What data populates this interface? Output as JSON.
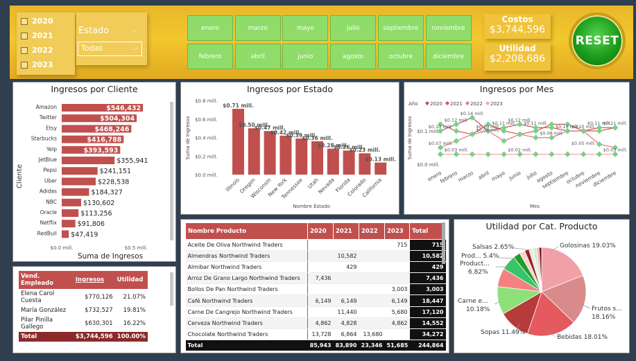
{
  "filters": {
    "years": [
      "2020",
      "2021",
      "2022",
      "2023"
    ],
    "estado_label": "Estado",
    "estado_value": "Todas",
    "months": [
      "enero",
      "marzo",
      "mayo",
      "julio",
      "septiembre",
      "noviembre",
      "febrero",
      "abril",
      "junio",
      "agosto",
      "octubre",
      "diciembre"
    ]
  },
  "kpis": {
    "costos_label": "Costos",
    "costos_value": "$3,744,596",
    "utilidad_label": "Utilidad",
    "utilidad_value": "$2,208,686"
  },
  "reset_label": "RESET",
  "colors": {
    "accent": "#c0504d",
    "green": "#8fdc6b",
    "gold": "#f0c33a"
  },
  "clientes": {
    "title": "Ingresos por Cliente",
    "ylabel": "Cliente",
    "xlabel": "Suma de Ingresos",
    "ticks": [
      "$0.0 mill.",
      "$0.5 mill."
    ],
    "chart_data": {
      "type": "bar",
      "categories": [
        "Amazon",
        "Twitter",
        "Etsy",
        "Starbucks",
        "Yelp",
        "JetBlue",
        "Pepsi",
        "Uber",
        "Adidas",
        "NBC",
        "Oracle",
        "Netflix",
        "RedBull"
      ],
      "values": [
        546432,
        504304,
        468246,
        416788,
        393593,
        355941,
        241151,
        228538,
        184327,
        130602,
        113256,
        91806,
        47419
      ],
      "labels": [
        "$546,432",
        "$504,304",
        "$468,246",
        "$416,788",
        "$393,593",
        "$355,941",
        "$241,151",
        "$228,538",
        "$184,327",
        "$130,602",
        "$113,256",
        "$91,806",
        "$47,419"
      ],
      "xlim": [
        0,
        700000
      ]
    }
  },
  "estado": {
    "title": "Ingresos por Estado",
    "ylabel": "Suma de Ingresos",
    "xlabel": "Nombre Estado",
    "yticks": [
      "$0.8 mill.",
      "$0.6 mill.",
      "$0.4 mill.",
      "$0.2 mill.",
      "$0.0 mill."
    ],
    "chart_data": {
      "type": "bar",
      "categories": [
        "Illinois",
        "Oregon",
        "Wisconsin",
        "New York",
        "Tennessee",
        "Utah",
        "Nevada",
        "Florida",
        "Colorado",
        "California"
      ],
      "values": [
        0.71,
        0.5,
        0.47,
        0.42,
        0.39,
        0.36,
        0.28,
        0.26,
        0.23,
        0.13
      ],
      "labels": [
        "$0.71 mill.",
        "$0.50 mill.",
        "$0.47 mill.",
        "$0.42 mill.",
        "$0.39 mill.",
        "$0.36 mill.",
        "$0.28 mill.",
        "$0.26 mill.",
        "$0.23 mill.",
        "$0.13 mill."
      ],
      "ylim": [
        0,
        0.8
      ]
    }
  },
  "mes": {
    "title": "Ingresos por Mes",
    "ylabel": "Suma de Ingresos",
    "xlabel": "Mes",
    "legend_label": "Año",
    "yticks": [
      "$0.1 mill.",
      "$0.0 mill."
    ],
    "chart_data": {
      "type": "line",
      "x": [
        "enero",
        "febrero",
        "marzo",
        "abril",
        "mayo",
        "junio",
        "julio",
        "agosto",
        "septiembre",
        "octubre",
        "noviembre",
        "diciembre"
      ],
      "ylim": [
        0,
        0.15
      ],
      "series": [
        {
          "name": "2020",
          "color": "#c0504d",
          "values": [
            0.1,
            0.12,
            0.14,
            0.1,
            0.11,
            0.12,
            0.11,
            0.11,
            0.1,
            0.1,
            0.11,
            0.11
          ]
        },
        {
          "name": "2021",
          "color": "#d9534f",
          "values": [
            0.12,
            0.1,
            0.09,
            0.12,
            0.1,
            0.09,
            0.1,
            0.12,
            0.12,
            0.1,
            0.1,
            0.11
          ]
        },
        {
          "name": "2022",
          "color": "#e07a7a",
          "values": [
            0.05,
            0.07,
            0.09,
            0.1,
            0.07,
            0.09,
            0.08,
            0.08,
            0.1,
            0.1,
            0.06,
            0.05
          ]
        },
        {
          "name": "2023",
          "color": "#f2a9a9",
          "values": [
            0.03,
            0.03,
            0.03,
            0.03,
            0.03,
            0.03,
            0.03,
            0.03,
            0.03,
            0.03,
            0.03,
            0.03
          ]
        }
      ],
      "point_labels": [
        {
          "text": "$0.10 mill.",
          "m": 0,
          "v": 0.1
        },
        {
          "text": "$0.12 mill.",
          "m": 1,
          "v": 0.12
        },
        {
          "text": "$0.14 mill.",
          "m": 2,
          "v": 0.14
        },
        {
          "text": "$0.10 mill.",
          "m": 3,
          "v": 0.1
        },
        {
          "text": "$0.11 mill.",
          "m": 4,
          "v": 0.11
        },
        {
          "text": "$0.12 mill.",
          "m": 5,
          "v": 0.12
        },
        {
          "text": "$0.11 mill.",
          "m": 6,
          "v": 0.11
        },
        {
          "text": "$0.08 mill.",
          "m": 7,
          "v": 0.08
        },
        {
          "text": "$0.10 mill.",
          "m": 8,
          "v": 0.1
        },
        {
          "text": "$0.10 mill.",
          "m": 9,
          "v": 0.1
        },
        {
          "text": "$0.11 mill.",
          "m": 10,
          "v": 0.11
        },
        {
          "text": "$0.11 mill.",
          "m": 11,
          "v": 0.11
        },
        {
          "text": "$0.07 mill.",
          "m": 0,
          "v": 0.05
        },
        {
          "text": "$0.03 mill.",
          "m": 1,
          "v": 0.03
        },
        {
          "text": "$0.09 mill.",
          "m": 3,
          "v": 0.09
        },
        {
          "text": "$0.02 mill.",
          "m": 5,
          "v": 0.03
        },
        {
          "text": "$0.05 mill.",
          "m": 9,
          "v": 0.05
        },
        {
          "text": "$0.03 mill.",
          "m": 11,
          "v": 0.03
        }
      ]
    }
  },
  "empleados": {
    "headers": [
      "Vend. Empleado",
      "Ingresos",
      "Utilidad"
    ],
    "rows": [
      [
        "Elena Carol Cuesta",
        "$770,126",
        "21.07%"
      ],
      [
        "María González",
        "$732,527",
        "19.81%"
      ],
      [
        "Pilar Pinilla Gallego",
        "$630,301",
        "16.22%"
      ]
    ],
    "total": [
      "Total",
      "$3,744,596",
      "100.00%"
    ]
  },
  "productos": {
    "headers": [
      "Nombre Producto",
      "2020",
      "2021",
      "2022",
      "2023",
      "Total"
    ],
    "rows": [
      [
        "Aceite De Oliva Northwind Traders",
        "",
        "",
        "",
        "715",
        "715"
      ],
      [
        "Almendras Northwind Traders",
        "",
        "10,582",
        "",
        "",
        "10,582"
      ],
      [
        "Almibar Northwind Traders",
        "",
        "429",
        "",
        "",
        "429"
      ],
      [
        "Arroz De Grano Largo Northwind Traders",
        "7,436",
        "",
        "",
        "",
        "7,436"
      ],
      [
        "Bollos De Pan Northwind Traders",
        "",
        "",
        "",
        "3,003",
        "3,003"
      ],
      [
        "Café Northwind Traders",
        "6,149",
        "6,149",
        "",
        "6,149",
        "18,447"
      ],
      [
        "Carne De Cangrejo Northwind Traders",
        "",
        "11,440",
        "",
        "5,680",
        "17,120"
      ],
      [
        "Cerveza Northwind Traders",
        "4,862",
        "4,828",
        "",
        "4,862",
        "14,552"
      ],
      [
        "Chocolate Northwind Traders",
        "13,728",
        "6,864",
        "13,680",
        "",
        "34,272"
      ]
    ],
    "total": [
      "Total",
      "85,943",
      "83,890",
      "23,346",
      "51,685",
      "244,864"
    ]
  },
  "utilidad_cat": {
    "title": "Utilidad por Cat. Producto",
    "chart_data": {
      "type": "pie",
      "labels": [
        "Golosinas 19.03%",
        "Frutos s... 18.16%",
        "Bebidas 18.01%",
        "Sopas 11.49%",
        "Carne e... 10.18%",
        "Product... 6.82%",
        "Prod... 5.4%",
        "Salsas 2.65%"
      ],
      "categories": [
        "Golosinas",
        "Frutos s...",
        "Bebidas",
        "Sopas",
        "Carne e...",
        "Product...",
        "Prod...",
        "Salsas"
      ],
      "values": [
        19.03,
        18.16,
        18.01,
        11.49,
        10.18,
        6.82,
        5.4,
        2.65
      ],
      "other_values": [
        2.0,
        1.6,
        1.5,
        1.2,
        1.0,
        0.96
      ],
      "colors": [
        "#f2a0a8",
        "#d98b8b",
        "#e45a5f",
        "#b73b3b",
        "#8ee07a",
        "#f48080",
        "#39c46a",
        "#1f9d2a"
      ]
    }
  }
}
